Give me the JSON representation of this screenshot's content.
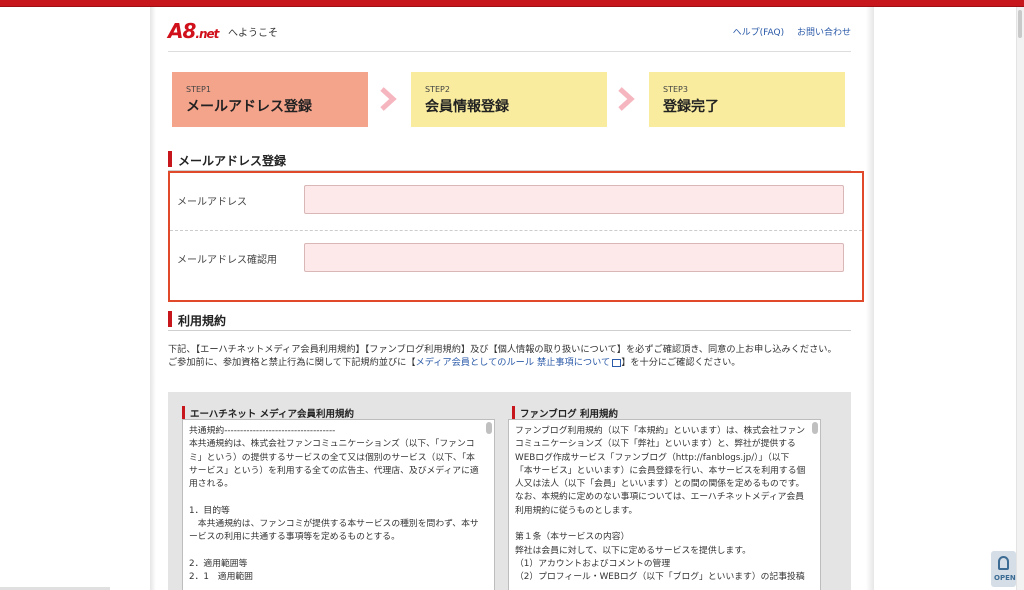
{
  "header": {
    "logo_main": "A8",
    "logo_suffix": ".net",
    "welcome": "へようこそ",
    "links": [
      "ヘルプ(FAQ)",
      "お問い合わせ"
    ]
  },
  "steps": [
    {
      "num": "STEP1",
      "title": "メールアドレス登録",
      "active": true
    },
    {
      "num": "STEP2",
      "title": "会員情報登録",
      "active": false
    },
    {
      "num": "STEP3",
      "title": "登録完了",
      "active": false
    }
  ],
  "email_section": {
    "heading": "メールアドレス登録",
    "email_label": "メールアドレス",
    "email_value": "",
    "confirm_label": "メールアドレス確認用",
    "confirm_value": ""
  },
  "terms_section": {
    "heading": "利用規約",
    "line1": "下記、【エーハチネットメディア会員利用規約】【ファンブログ利用規約】及び【個人情報の取り扱いについて】を必ずご確認頂き、同意の上お申し込みください。",
    "line2_pre": "ご参加前に、参加資格と禁止行為に関して下記規約並びに【",
    "line2_link": "メディア会員としてのルール 禁止事項について",
    "line2_post": "】を十分にご確認ください。"
  },
  "terms_left": {
    "heading": "エーハチネット メディア会員利用規約",
    "body": "共通規約-----------------------------------\n本共通規約は、株式会社ファンコミュニケーションズ（以下、「ファンコミ」という）の提供するサービスの全て又は個別のサービス（以下、「本サービス」という）を利用する全ての広告主、代理店、及びメディアに適用される。\n\n1．目的等\n　本共通規約は、ファンコミが提供する本サービスの種別を問わず、本サービスの利用に共通する事項等を定めるものとする。\n\n2．適用範囲等\n2．1　適用範囲"
  },
  "terms_right": {
    "heading": "ファンブログ 利用規約",
    "body": "ファンブログ利用規約（以下「本規約」といいます）は、株式会社ファンコミュニケーションズ（以下「弊社」といいます）と、弊社が提供するWEBログ作成サービス「ファンブログ（http://fanblogs.jp/）」（以下「本サービス」といいます）に会員登録を行い、本サービスを利用する個人又は法人（以下「会員」といいます）との間の関係を定めるものです。なお、本規約に定めのない事項については、エーハチネットメディア会員利用規約に従うものとします。\n\n第１条（本サービスの内容）\n弊社は会員に対して、以下に定めるサービスを提供します。\n（1）アカウントおよびコメントの管理\n（2）プロフィール・WEBログ（以下「ブログ」といいます）の記事投稿"
  },
  "open_button": {
    "label": "OPEN"
  },
  "colors": {
    "brand_red": "#c8161d",
    "step_active": "#f5a48c",
    "step_inactive": "#f9ec9e",
    "link": "#2b5aa8",
    "highlight_border": "#e04a2b"
  }
}
